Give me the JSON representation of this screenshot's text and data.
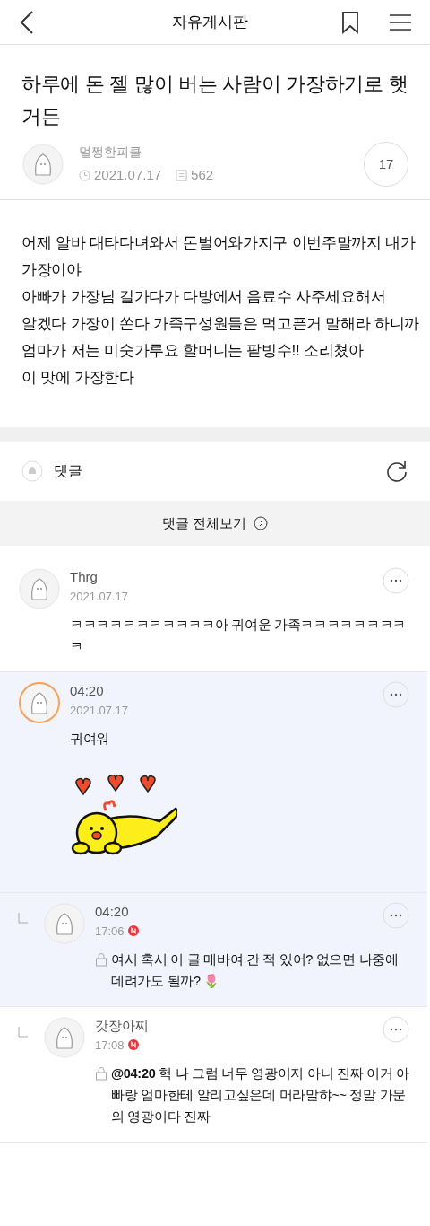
{
  "header": {
    "title": "자유게시판"
  },
  "post": {
    "title": "하루에 돈 젤 많이 버는 사람이 가장하기로 햇거든",
    "author": "멀쩡한피클",
    "date": "2021.07.17",
    "views": "562",
    "comment_count": "17",
    "body": [
      "어제 알바 대타다녀와서 돈벌어와가지구 이번주말까지 내가 가장이야",
      "아빠가 가장님 길가다가 다방에서 음료수 사주세요해서",
      "알겠다 가장이 쏜다 가족구성원들은 먹고픈거 말해라 하니까",
      "엄마가 저는 미숫가루요 할머니는 팥빙수!! 소리쳤아",
      "이 맛에 가장한다"
    ]
  },
  "comments_section": {
    "title": "댓글",
    "view_all": "댓글 전체보기"
  },
  "comments": [
    {
      "author": "Thrg",
      "time": "2021.07.17",
      "text": "ㅋㅋㅋㅋㅋㅋㅋㅋㅋㅋㅋ아 귀여운 가족ㅋㅋㅋㅋㅋㅋㅋㅋㅋ",
      "reply": false,
      "highlighted": false,
      "new": false,
      "locked": false,
      "ring": false,
      "sticker": false
    },
    {
      "author": "04:20",
      "time": "2021.07.17",
      "text": "귀여워",
      "reply": false,
      "highlighted": true,
      "new": false,
      "locked": false,
      "ring": true,
      "sticker": true
    },
    {
      "author": "04:20",
      "time": "17:06",
      "text": "여시 혹시 이 글 메바여 간 적 있어? 없으면 나중에 데려가도 될까? 🌷",
      "reply": true,
      "highlighted": true,
      "new": true,
      "locked": true,
      "ring": false,
      "sticker": false
    },
    {
      "author": "갓장아찌",
      "time": "17:08",
      "text": "**@04:20**  헉 나 그럼 너무 영광이지 아니 진짜 이거 아빠랑 엄마한테 알리고싶은데 머라말햐~~ 정말 가문의 영광이다 진짜",
      "reply": true,
      "highlighted": false,
      "new": true,
      "locked": true,
      "ring": false,
      "sticker": false
    }
  ]
}
